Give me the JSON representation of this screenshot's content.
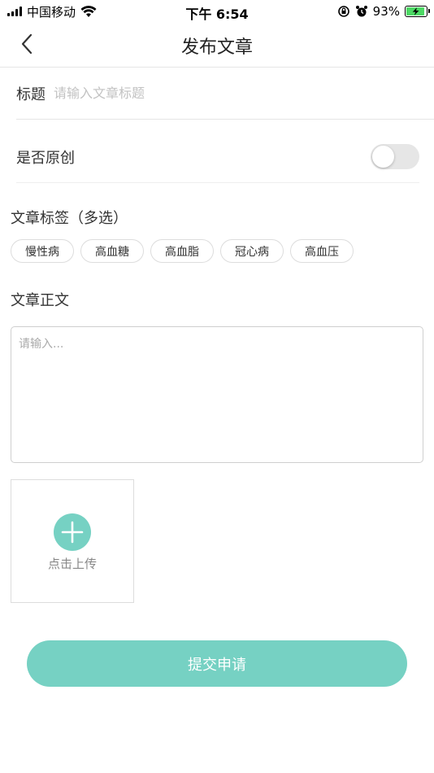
{
  "status_bar": {
    "carrier": "中国移动",
    "time": "下午 6:54",
    "battery_percent": "93%",
    "battery_level": 0.93,
    "icons": [
      "signal-icon",
      "wifi-icon",
      "orientation-lock-icon",
      "alarm-icon",
      "battery-icon"
    ]
  },
  "nav": {
    "title": "发布文章",
    "back_icon": "chevron-left-icon"
  },
  "form": {
    "title_label": "标题",
    "title_placeholder": "请输入文章标题",
    "title_value": "",
    "original_label": "是否原创",
    "original_on": false,
    "tags_label": "文章标签（多选）",
    "tags": [
      "慢性病",
      "高血糖",
      "高血脂",
      "冠心病",
      "高血压"
    ],
    "body_label": "文章正文",
    "body_placeholder": "请输入...",
    "body_value": "",
    "upload_label": "点击上传",
    "upload_icon": "plus-icon",
    "submit_label": "提交申请"
  },
  "colors": {
    "accent": "#76d1c3",
    "toggle_off": "#e6e6e6",
    "battery_green": "#4cd964"
  }
}
